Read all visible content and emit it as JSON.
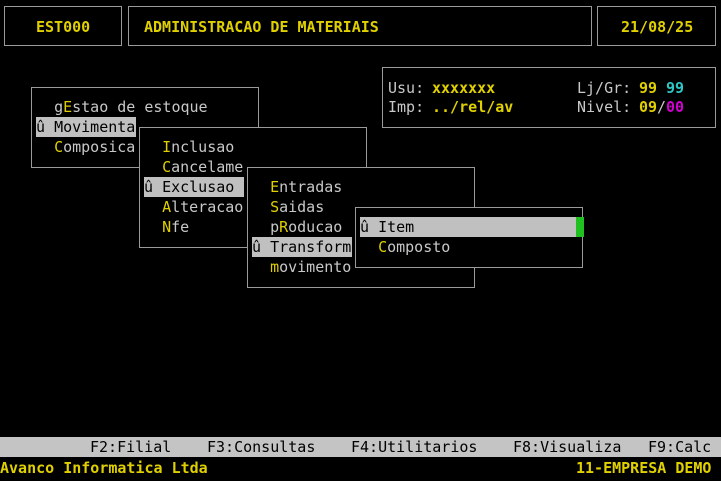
{
  "header": {
    "code": "EST000",
    "title": "ADMINISTRACAO DE MATERIAIS",
    "date": "21/08/25"
  },
  "info": {
    "user_label": "Usu:",
    "user_value": "xxxxxxx",
    "printer_label": "Imp:",
    "printer_value": "../rel/av",
    "store_label": "Lj/Gr:",
    "store_value": "99",
    "group_value": "99",
    "level_label": "Nivel:",
    "level_value": "09",
    "level_sep": "/",
    "level_value2": "00"
  },
  "menu1": {
    "items": [
      {
        "pre": "g",
        "hot": "E",
        "post": "stao de estoque"
      },
      {
        "pre": "û ",
        "hot": "M",
        "post": "ovimenta"
      },
      {
        "pre": "",
        "hot": "C",
        "post": "omposica"
      }
    ]
  },
  "menu2": {
    "items": [
      {
        "pre": "",
        "hot": "I",
        "post": "nclusao"
      },
      {
        "pre": "",
        "hot": "C",
        "post": "ancelame"
      },
      {
        "pre": "û ",
        "hot": "E",
        "post": "xclusao"
      },
      {
        "pre": "",
        "hot": "A",
        "post": "lteracao"
      },
      {
        "pre": "",
        "hot": "N",
        "post": "fe"
      }
    ]
  },
  "menu3": {
    "items": [
      {
        "pre": "",
        "hot": "E",
        "post": "ntradas"
      },
      {
        "pre": "",
        "hot": "S",
        "post": "aidas"
      },
      {
        "pre": "p",
        "hot": "R",
        "post": "oducao"
      },
      {
        "pre": "û ",
        "hot": "T",
        "post": "ransform"
      },
      {
        "pre": "",
        "hot": "m",
        "post": "ovimento"
      }
    ]
  },
  "menu4": {
    "items": [
      {
        "pre": "û ",
        "hot": "I",
        "post": "tem"
      },
      {
        "pre": "",
        "hot": "C",
        "post": "omposto"
      }
    ]
  },
  "fkeys": [
    "F2:Filial",
    "F3:Consultas",
    "F4:Utilitarios",
    "F8:Visualiza",
    "F9:Calc"
  ],
  "footer": {
    "company": "Avanco Informatica Ltda",
    "branch": "11-EMPRESA DEMO"
  },
  "colors": {
    "background": "#000000",
    "text": "#c8c8c8",
    "accent_yellow": "#e0d000",
    "accent_cyan": "#2ec8c8",
    "accent_magenta": "#d000d0",
    "selection": "#c0c0c0",
    "cursor": "#20c020"
  }
}
